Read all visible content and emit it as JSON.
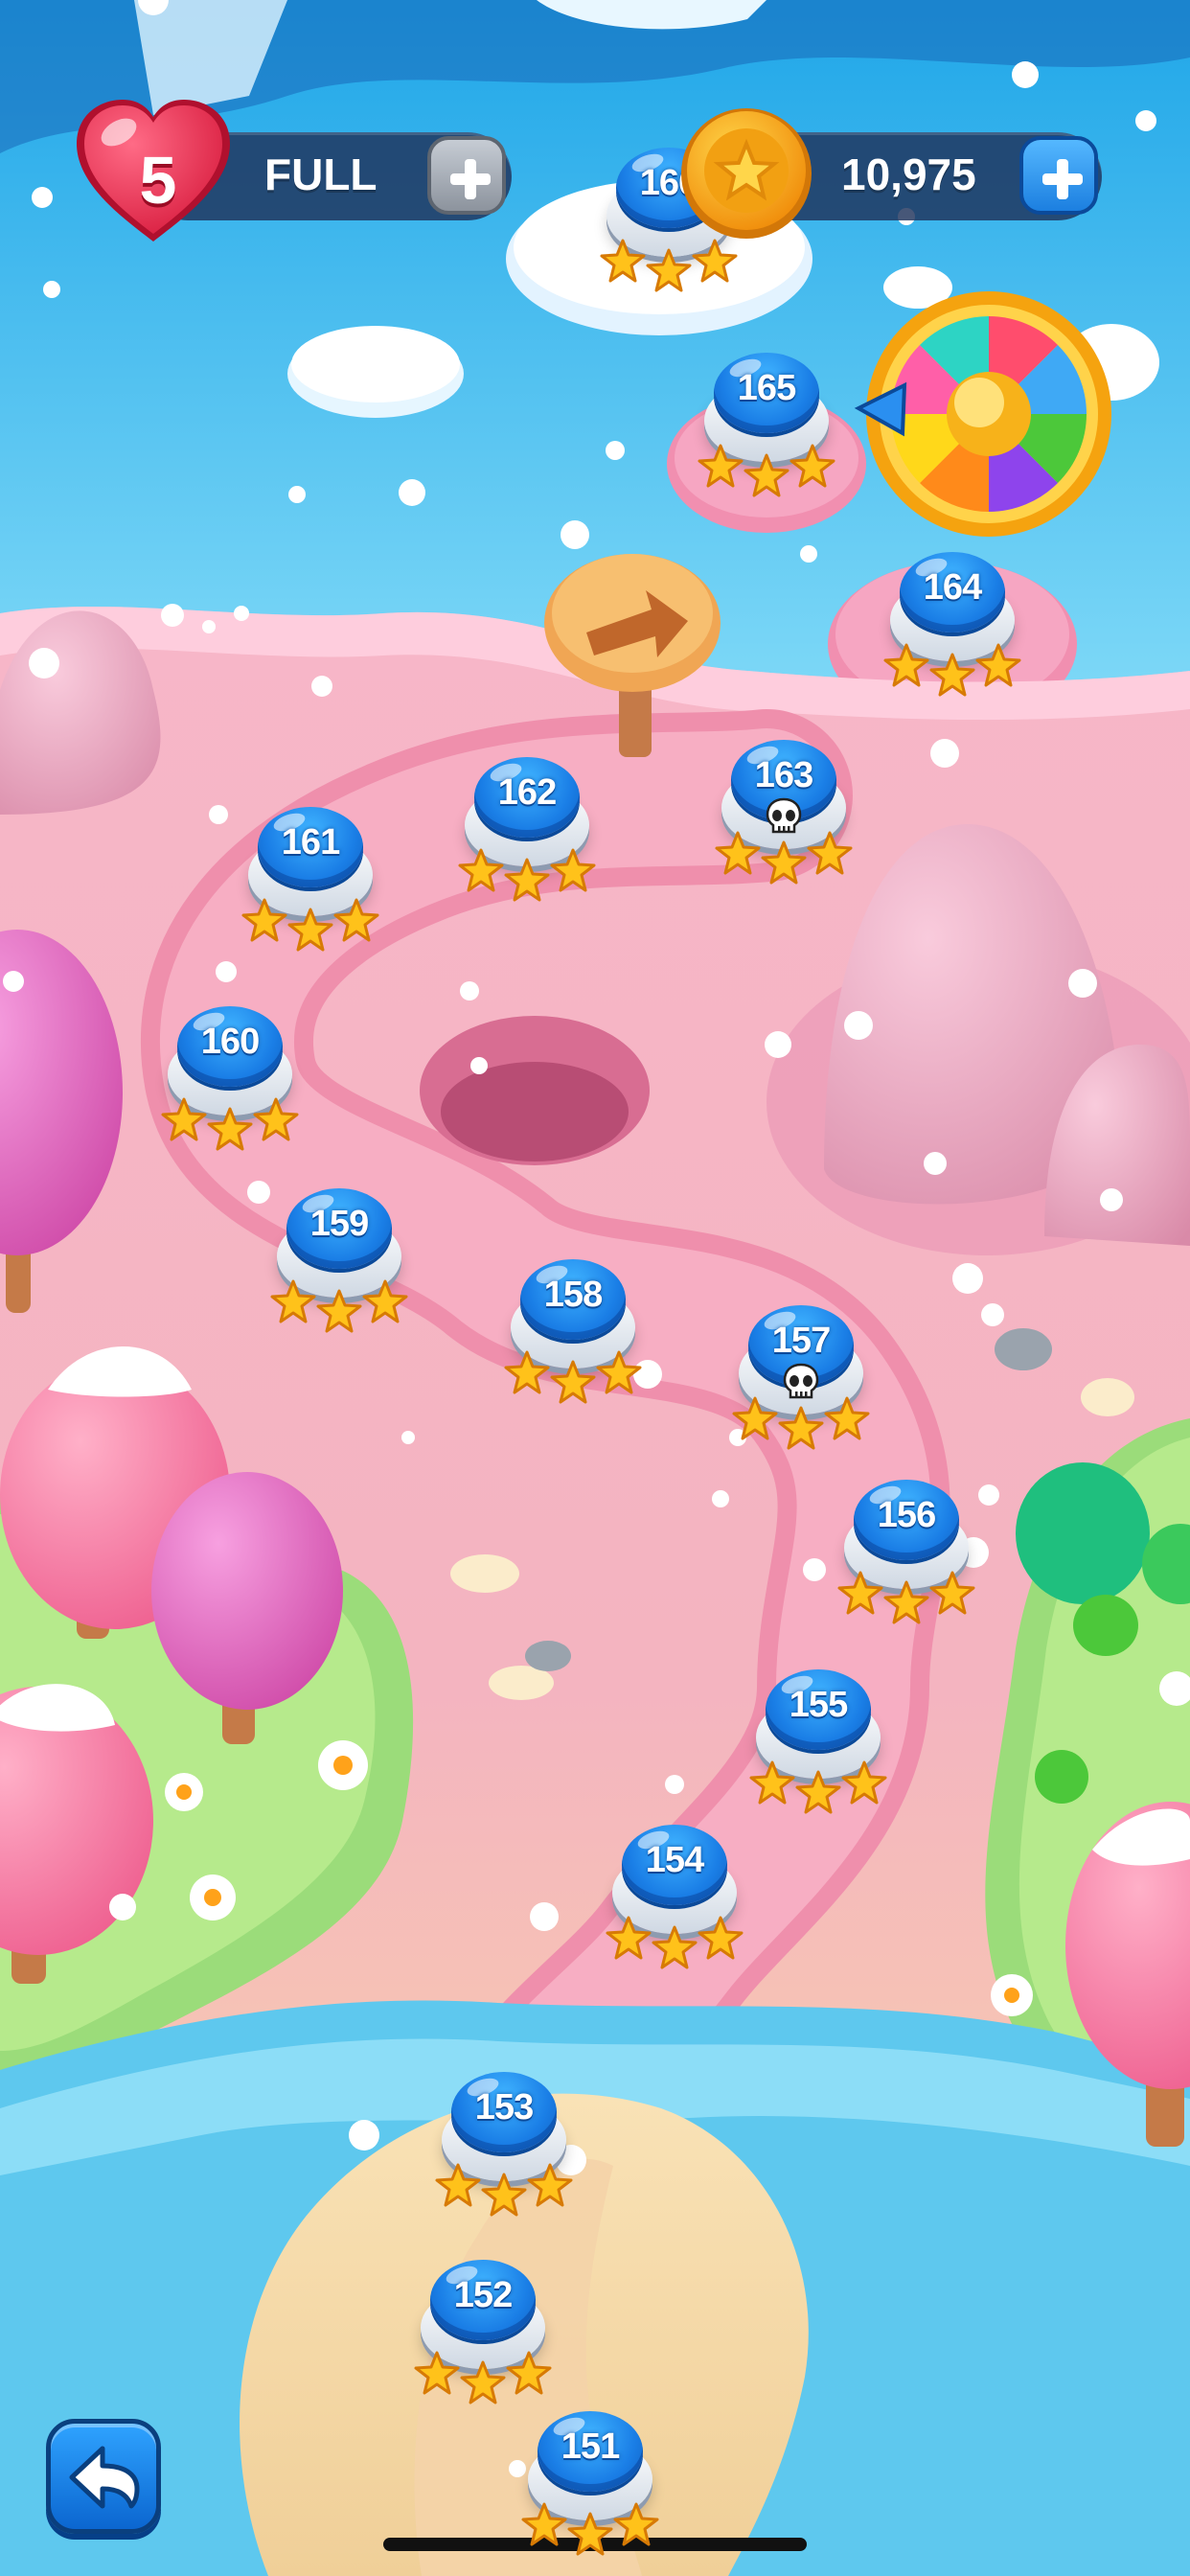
{
  "hud": {
    "lives_count": "5",
    "lives_status": "FULL",
    "coins": "10,975"
  },
  "levels": [
    {
      "number": "151",
      "stars": 3,
      "skull": false
    },
    {
      "number": "152",
      "stars": 3,
      "skull": false
    },
    {
      "number": "153",
      "stars": 3,
      "skull": false
    },
    {
      "number": "154",
      "stars": 3,
      "skull": false
    },
    {
      "number": "155",
      "stars": 3,
      "skull": false
    },
    {
      "number": "156",
      "stars": 3,
      "skull": false
    },
    {
      "number": "157",
      "stars": 3,
      "skull": true
    },
    {
      "number": "158",
      "stars": 3,
      "skull": false
    },
    {
      "number": "159",
      "stars": 3,
      "skull": false
    },
    {
      "number": "160",
      "stars": 3,
      "skull": false
    },
    {
      "number": "161",
      "stars": 3,
      "skull": false
    },
    {
      "number": "162",
      "stars": 3,
      "skull": false
    },
    {
      "number": "163",
      "stars": 3,
      "skull": true
    },
    {
      "number": "164",
      "stars": 3,
      "skull": false
    },
    {
      "number": "165",
      "stars": 3,
      "skull": false
    },
    {
      "number": "166",
      "stars": 3,
      "skull": false
    }
  ],
  "icons": {
    "lives": "heart-icon",
    "coins": "star-coin-icon",
    "add": "plus-icon",
    "wheel": "spin-wheel-icon",
    "signpost": "arrow-signpost-icon",
    "back": "back-arrow-icon",
    "skull": "skull-icon",
    "star": "star-icon"
  },
  "colors": {
    "level_button": "#1a7ee6",
    "star": "#ffc21a",
    "heart": "#e8284a",
    "coin": "#f5a30f",
    "hud_pill": "#1e325a",
    "coin_plus": "#1c8ef0",
    "lives_plus": "#9aa1ab"
  }
}
